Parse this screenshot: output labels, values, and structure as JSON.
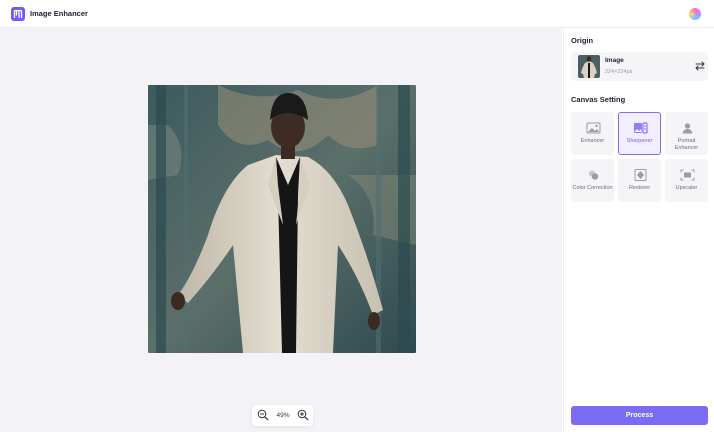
{
  "app": {
    "title": "Image Enhancer",
    "logo_icon": "app-logo-icon",
    "brand_color": "#6d5dfc"
  },
  "canvas": {
    "zoom": "49%"
  },
  "panel": {
    "origin_title": "Origin",
    "origin": {
      "name": "Image",
      "size": "224×224px"
    },
    "canvas_setting_title": "Canvas Setting",
    "tools": [
      {
        "label": "Enhancer",
        "icon": "enhancer-icon",
        "active": false
      },
      {
        "label": "Sharpener",
        "icon": "sharpener-icon",
        "active": true
      },
      {
        "label": "Portrait Enhancer",
        "icon": "portrait-icon",
        "active": false
      },
      {
        "label": "Color Correction",
        "icon": "color-correction-icon",
        "active": false
      },
      {
        "label": "Restorer",
        "icon": "restorer-icon",
        "active": false
      },
      {
        "label": "Upscaler",
        "icon": "upscaler-icon",
        "active": false
      }
    ],
    "process_label": "Process"
  }
}
